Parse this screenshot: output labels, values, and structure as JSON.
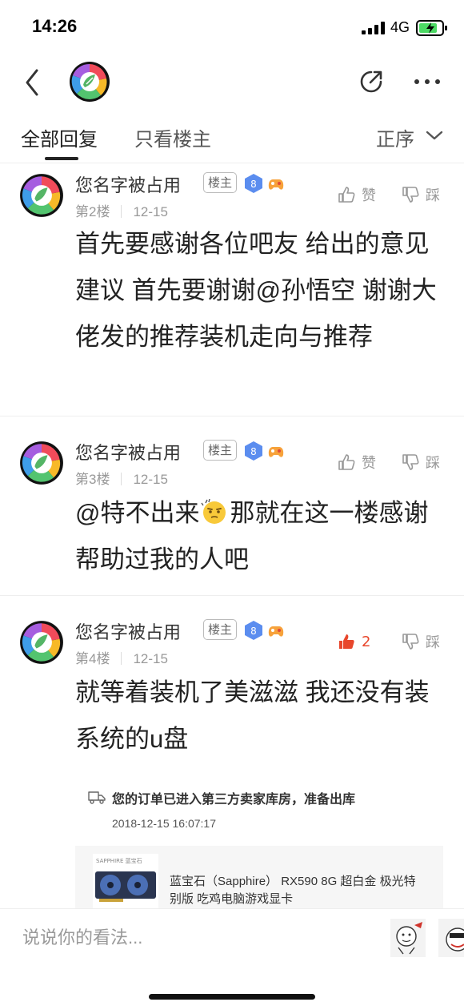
{
  "status_bar": {
    "time": "14:26",
    "network": "4G"
  },
  "nav": {
    "back_icon": "chevron-left-icon",
    "logo_icon": "forum-logo",
    "share_icon": "share-icon",
    "more_icon": "more-dots-icon"
  },
  "tabs": {
    "all_replies": "全部回复",
    "op_only": "只看楼主",
    "sort": "正序"
  },
  "posts": [
    {
      "username": "您名字被占用",
      "op_badge": "楼主",
      "level": "8",
      "floor": "第2楼",
      "date": "12-15",
      "like_label": "赞",
      "dislike_label": "踩",
      "content": "首先要感谢各位吧友 给出的意见建议 首先要谢谢@孙悟空 谢谢大佬发的推荐装机走向与推荐"
    },
    {
      "username": "您名字被占用",
      "op_badge": "楼主",
      "level": "8",
      "floor": "第3楼",
      "date": "12-15",
      "like_label": "赞",
      "dislike_label": "踩",
      "content_before_emoji": "@特不出来",
      "content_after_emoji": "那就在这一楼感谢帮助过我的人吧"
    },
    {
      "username": "您名字被占用",
      "op_badge": "楼主",
      "level": "8",
      "floor": "第4楼",
      "date": "12-15",
      "like_count": "2",
      "dislike_label": "踩",
      "content": "就等着装机了美滋滋 我还没有装系统的u盘",
      "order": {
        "status": "您的订单已进入第三方卖家库房，准备出库",
        "time": "2018-12-15 16:07:17",
        "product_brand": "SAPPHIRE 蓝宝石",
        "product_title": "蓝宝石（Sapphire） RX590 8G 超白金 极光特别版 吃鸡电脑游戏显卡"
      }
    }
  ],
  "composer": {
    "placeholder": "说说你的看法..."
  },
  "colors": {
    "accent_like": "#e8472c",
    "level_badge": "#5b8def",
    "text_primary": "#222222",
    "text_muted": "#999999"
  }
}
